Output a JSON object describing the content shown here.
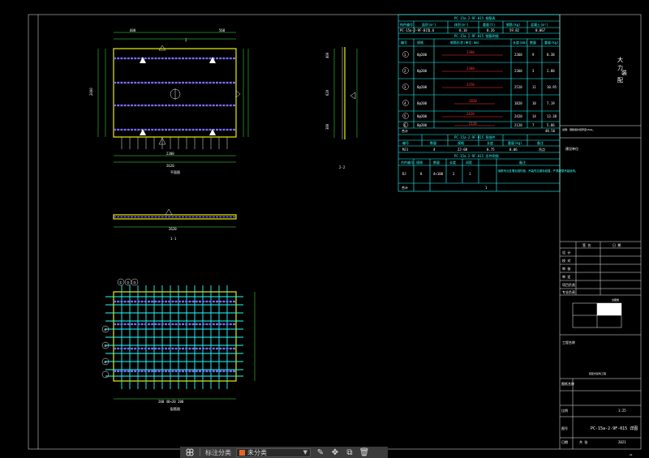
{
  "drawing": {
    "plan_caption": "平面图",
    "section_1_caption": "1-1",
    "section_2_caption": "2-2",
    "rebar_caption": "配筋图",
    "dim_top_left": "600",
    "dim_top_right": "560",
    "dim_bottom": "2300",
    "dim_bottom_total": "2620",
    "dim_left": "2000",
    "dim_right_a": "400",
    "dim_right_b": "620",
    "dim_right_c": "380",
    "dim_section": "2620",
    "dim_rebar_bottom": "200  40×20  200",
    "grid_labels": [
      "①",
      "②",
      "③",
      "④",
      "⑤",
      "⑥"
    ],
    "axis_mark_a": "2",
    "axis_mark_b": "1"
  },
  "table_main": {
    "title": "PC-15a-2-9F-015 钢筋表",
    "header": [
      "构件编号",
      "面积(m²)",
      "体积(m³)",
      "重量(t)",
      "钢筋(kg)",
      "混凝土(m³)"
    ],
    "row": [
      "PC-15a-2-9F-015",
      "1.6",
      "0.10",
      "0.26",
      "59.82",
      "0.067"
    ],
    "sub_title": "PC-15a-2-9F-015 钢筋明细",
    "sub_header": [
      "编号",
      "规格",
      "钢筋形状(单位:mm)",
      "长度(mm)",
      "数量",
      "重量(kg)"
    ],
    "rows": [
      [
        "1",
        "8@200",
        "2360",
        "2360",
        "9",
        "8.38"
      ],
      [
        "2",
        "8@200",
        "2360",
        "2360",
        "3",
        "2.80"
      ],
      [
        "3",
        "8@200",
        "2370",
        "2520",
        "11",
        "10.95"
      ],
      [
        "4",
        "8@200",
        "1820",
        "1820",
        "10",
        "7.19"
      ],
      [
        "5",
        "8@200",
        "2420",
        "2420",
        "14",
        "13.38"
      ],
      [
        "6",
        "8@200",
        "2120",
        "2120",
        "7",
        "5.86"
      ]
    ],
    "total_label": "合计",
    "total_value": "48.56",
    "embed_title": "PC-15a-2-9F-015 预埋件",
    "embed_header": [
      "编号",
      "数量",
      "规格",
      "长度",
      "重量(kg)",
      "备注"
    ],
    "embed_row": [
      "MJ1",
      "4",
      "ZJ-08",
      "0.75",
      "0.06",
      "吊点"
    ],
    "lift_title": "PC-15a-2-9F-015 吊件明细",
    "lift_header": [
      "吊件编号",
      "规格",
      "数量",
      "长度",
      "间距",
      "备注"
    ],
    "lift_row": [
      "DJ",
      "8",
      "4×100",
      "2",
      "1",
      ""
    ],
    "lift_note": "钢筋吊点处需加强构造，吊装时应避免碰撞，严禁超载吊装使用。",
    "lift_total": "合计",
    "lift_total_value": "1"
  },
  "title_block": {
    "company_chars": [
      "大",
      "力",
      "装",
      "配"
    ],
    "note_1": "说明：钢筋保护层厚度15mm。",
    "note_2": "建设单位",
    "header_left": "签  名",
    "header_right": "日  期",
    "rows": [
      "设  计",
      "校  对",
      "审  核",
      "审  定",
      "项目负责",
      "专业负责"
    ],
    "stamp_label": "出图章",
    "project_label": "工程名称",
    "project_value": "装配式建筑工程",
    "drawing_label": "图纸名称",
    "drawing_no_label": "图号",
    "drawing_no": "PC-15a-2-9F-015 详图",
    "scale_label": "比例",
    "scale": "1:25",
    "date_label": "日期",
    "date": "2021",
    "sheet_label": "共 张",
    "sheet": "A1"
  },
  "toolbar": {
    "filter_label": "标注分类",
    "category_value": "未分类",
    "category_color": "#e8641e"
  }
}
